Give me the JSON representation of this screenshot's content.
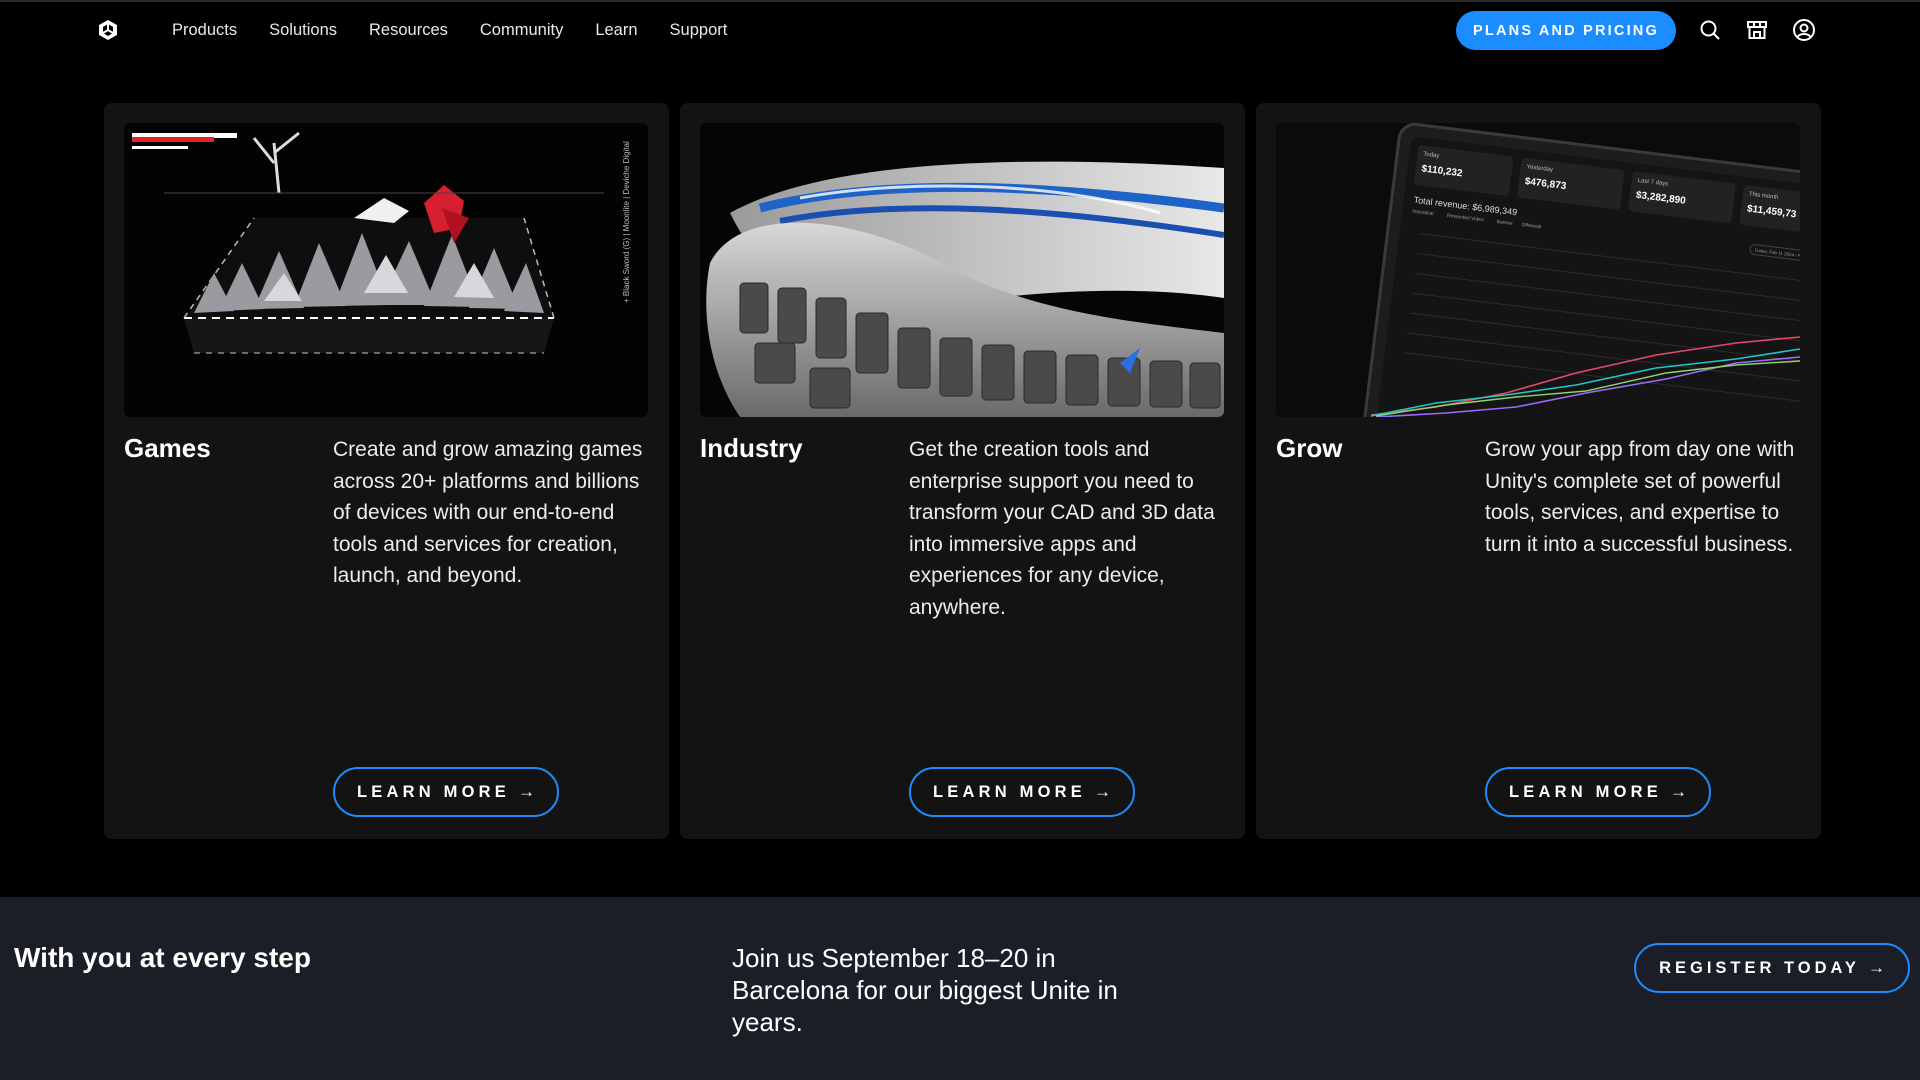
{
  "nav": {
    "logo": "unity-logo",
    "links": [
      "Products",
      "Solutions",
      "Resources",
      "Community",
      "Learn",
      "Support"
    ],
    "cta_label": "PLANS AND PRICING",
    "icons": [
      "search-icon",
      "store-icon",
      "account-icon"
    ]
  },
  "colors": {
    "accent": "#1b8dff",
    "background": "#000000",
    "card": "#131313",
    "band": "#1b1e26"
  },
  "cards": [
    {
      "title": "Games",
      "text": "Create and grow amazing games across 20+ platforms and billions of devices with our end-to-end tools and services for creation, launch, and beyond.",
      "button": "LEARN MORE",
      "image_caption": "+ Black Sword (G) | Moonlite | Deviche Digital"
    },
    {
      "title": "Industry",
      "text": "Get the creation tools and enterprise support you need to transform your CAD and 3D data into immersive apps and experiences for any device, anywhere.",
      "button": "LEARN MORE"
    },
    {
      "title": "Grow",
      "text": "Grow your app from day one with Unity's complete set of powerful tools, services, and expertise to turn it into a successful business.",
      "button": "LEARN MORE",
      "dashboard": {
        "stats": [
          {
            "label": "Today",
            "value": "$110,232"
          },
          {
            "label": "Yesterday",
            "value": "$476,873"
          },
          {
            "label": "Last 7 days",
            "value": "$3,282,890"
          },
          {
            "label": "This month",
            "value": "$11,459,73"
          }
        ],
        "total_label": "Total revenue: $6,989,349",
        "legend": [
          "Interstitial",
          "Rewarded Video",
          "Banner",
          "Offerwall"
        ],
        "date_range": "Dates: Feb 11 2024 - Feb 24 20"
      }
    }
  ],
  "band": {
    "title": "With you at every step",
    "text": "Join us September 18–20 in Barcelona for our biggest Unite in years.",
    "button": "REGISTER TODAY"
  }
}
